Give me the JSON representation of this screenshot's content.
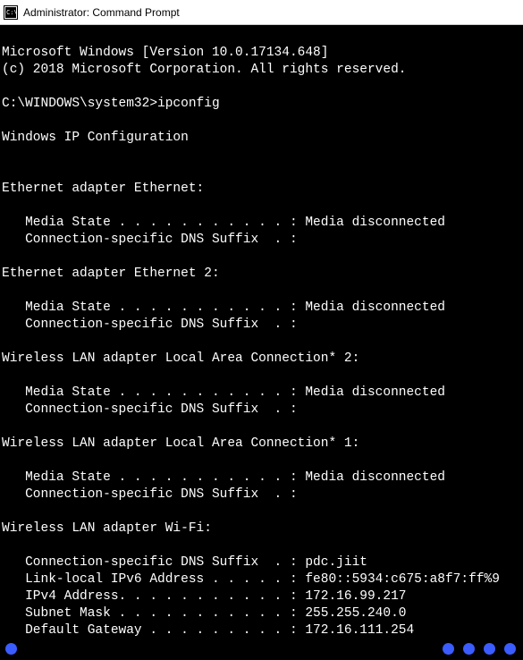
{
  "window": {
    "title": "Administrator: Command Prompt"
  },
  "terminal": {
    "header1": "Microsoft Windows [Version 10.0.17134.648]",
    "header2": "(c) 2018 Microsoft Corporation. All rights reserved.",
    "prompt": "C:\\WINDOWS\\system32>",
    "command": "ipconfig",
    "cfg_title": "Windows IP Configuration",
    "adapters": [
      {
        "title": "Ethernet adapter Ethernet:",
        "lines": [
          "   Media State . . . . . . . . . . . : Media disconnected",
          "   Connection-specific DNS Suffix  . :"
        ]
      },
      {
        "title": "Ethernet adapter Ethernet 2:",
        "lines": [
          "   Media State . . . . . . . . . . . : Media disconnected",
          "   Connection-specific DNS Suffix  . :"
        ]
      },
      {
        "title": "Wireless LAN adapter Local Area Connection* 2:",
        "lines": [
          "   Media State . . . . . . . . . . . : Media disconnected",
          "   Connection-specific DNS Suffix  . :"
        ]
      },
      {
        "title": "Wireless LAN adapter Local Area Connection* 1:",
        "lines": [
          "   Media State . . . . . . . . . . . : Media disconnected",
          "   Connection-specific DNS Suffix  . :"
        ]
      },
      {
        "title": "Wireless LAN adapter Wi-Fi:",
        "lines": [
          "   Connection-specific DNS Suffix  . : pdc.jiit",
          "   Link-local IPv6 Address . . . . . : fe80::5934:c675:a8f7:ff%9",
          "   IPv4 Address. . . . . . . . . . . : 172.16.99.217",
          "   Subnet Mask . . . . . . . . . . . : 255.255.240.0",
          "   Default Gateway . . . . . . . . . : 172.16.111.254"
        ]
      }
    ]
  }
}
